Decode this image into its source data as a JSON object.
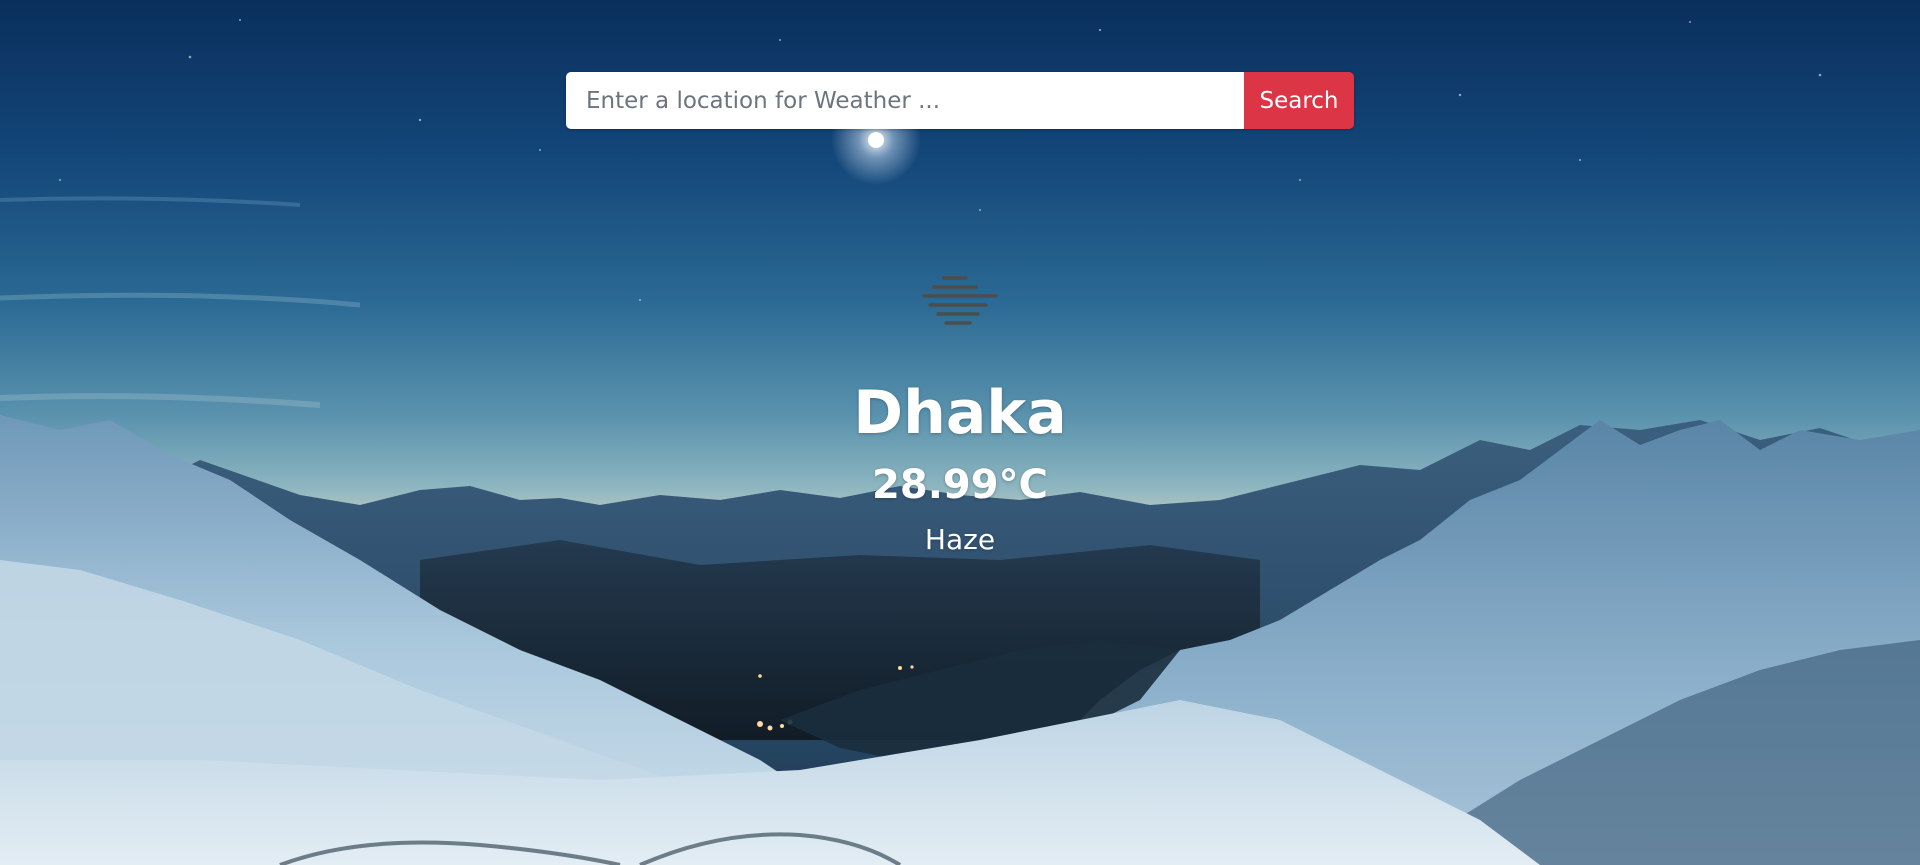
{
  "search": {
    "placeholder": "Enter a location for Weather ...",
    "value": "",
    "button_label": "Search",
    "button_color": "#dc3545"
  },
  "weather": {
    "icon": "haze-icon",
    "city": "Dhaka",
    "temperature": "28.99°C",
    "condition": "Haze"
  },
  "background": {
    "description_icon": "mountain-night-background"
  }
}
